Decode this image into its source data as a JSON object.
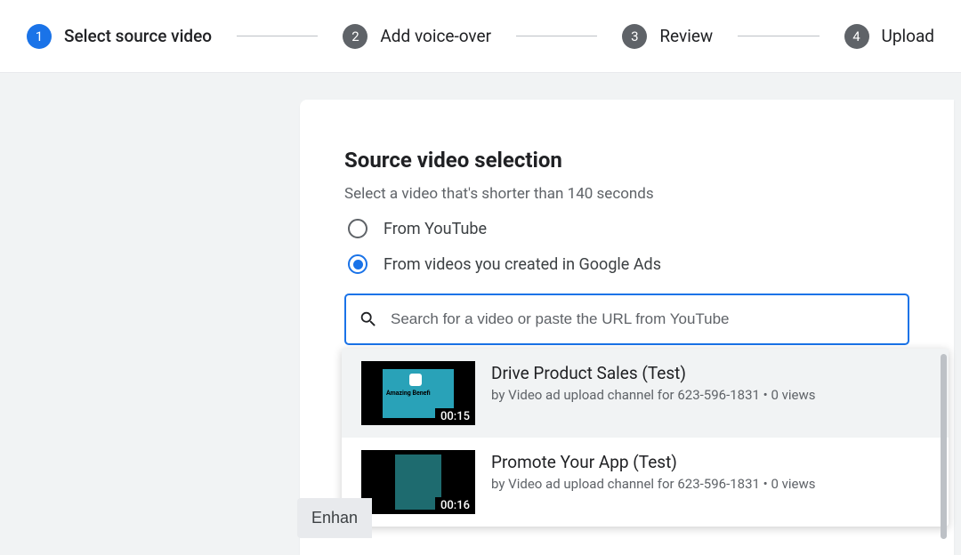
{
  "stepper": {
    "steps": [
      {
        "num": "1",
        "label": "Select source video",
        "active": true
      },
      {
        "num": "2",
        "label": "Add voice-over",
        "active": false
      },
      {
        "num": "3",
        "label": "Review",
        "active": false
      },
      {
        "num": "4",
        "label": "Upload",
        "active": false
      }
    ]
  },
  "card": {
    "title": "Source video selection",
    "subtitle": "Select a video that's shorter than 140 seconds"
  },
  "radios": {
    "youtube": "From YouTube",
    "google_ads": "From videos you created in Google Ads"
  },
  "search": {
    "placeholder": "Search for a video or paste the URL from YouTube"
  },
  "videos": [
    {
      "title": "Drive Product Sales (Test)",
      "meta": "by Video ad upload channel for 623-596-1831 • 0 views",
      "duration": "00:15",
      "thumb_text": "Amazing Benefi"
    },
    {
      "title": "Promote Your App (Test)",
      "meta": "by Video ad upload channel for 623-596-1831 • 0 views",
      "duration": "00:16",
      "thumb_text": ""
    }
  ],
  "enhance_button": "Enhan"
}
